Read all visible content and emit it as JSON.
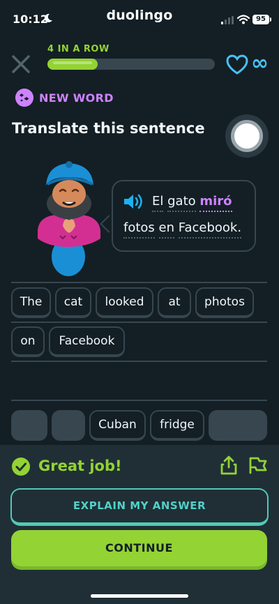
{
  "status_bar": {
    "time": "10:12",
    "brand": "duolingo",
    "battery": "95",
    "icons": [
      "moon-icon",
      "signal-icon",
      "wifi-icon",
      "battery-icon"
    ]
  },
  "header": {
    "streak_text": "4 IN A ROW",
    "progress": 0.3,
    "hearts": "∞",
    "accent_green": "#93d334",
    "hearts_color": "#49c0f8"
  },
  "badge": {
    "label": "NEW WORD",
    "color": "#ce82ff"
  },
  "title": "Translate this sentence",
  "prompt": {
    "line1": [
      "El",
      "gato",
      "miró"
    ],
    "line2": [
      "fotos",
      "en",
      "Facebook."
    ],
    "highlight_word": "miró"
  },
  "answer_tiles": [
    "The",
    "cat",
    "looked",
    "at",
    "photos",
    "on",
    "Facebook"
  ],
  "word_bank": [
    "Cuban",
    "fridge"
  ],
  "feedback": {
    "message": "Great job!",
    "explain_label": "EXPLAIN MY ANSWER",
    "continue_label": "CONTINUE"
  }
}
